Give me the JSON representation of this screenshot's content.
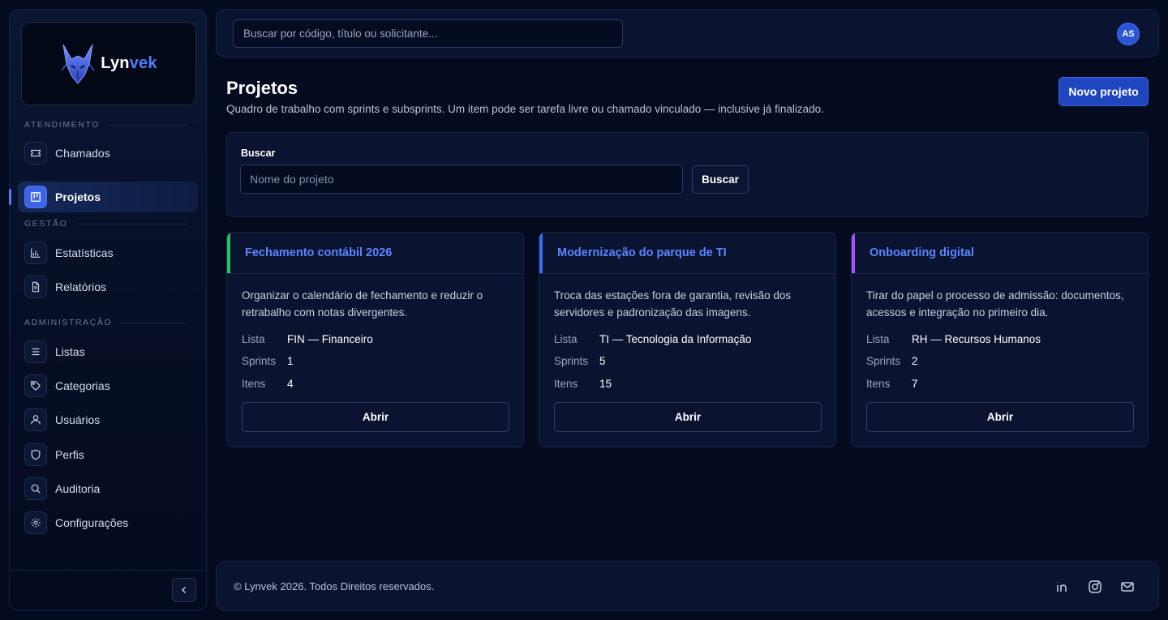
{
  "brand": {
    "name_prefix": "Lyn",
    "name_suffix": "vek",
    "accent_color": "#4f7dff"
  },
  "sidebar": {
    "sections": [
      {
        "title": "ATENDIMENTO"
      },
      {
        "title": "GESTÃO"
      },
      {
        "title": "ADMINISTRAÇÃO"
      }
    ],
    "items": [
      {
        "label": "Chamados",
        "icon": "ticket-icon"
      },
      {
        "label": "Projetos",
        "icon": "kanban-icon",
        "active": true
      },
      {
        "label": "Estatísticas",
        "icon": "bar-chart-icon"
      },
      {
        "label": "Relatórios",
        "icon": "document-icon"
      },
      {
        "label": "Listas",
        "icon": "list-icon"
      },
      {
        "label": "Categorias",
        "icon": "tag-icon"
      },
      {
        "label": "Usuários",
        "icon": "user-icon"
      },
      {
        "label": "Perfis",
        "icon": "shield-icon"
      },
      {
        "label": "Auditoria",
        "icon": "search-icon"
      },
      {
        "label": "Configurações",
        "icon": "gear-icon"
      }
    ],
    "collapse_icon": "chevron-left-icon"
  },
  "topbar": {
    "search_placeholder": "Buscar por código, título ou solicitante...",
    "avatar_initials": "AS"
  },
  "header": {
    "title": "Projetos",
    "subtitle": "Quadro de trabalho com sprints e subsprints. Um item pode ser tarefa livre ou chamado vinculado — inclusive já finalizado.",
    "new_button": "Novo projeto"
  },
  "search": {
    "label": "Buscar",
    "placeholder": "Nome do projeto",
    "button": "Buscar"
  },
  "cards": [
    {
      "title": "Fechamento contábil 2026",
      "accent": "#22c55e",
      "description": "Organizar o calendário de fechamento e reduzir o retrabalho com notas divergentes.",
      "lista_label": "Lista",
      "lista": "FIN — Financeiro",
      "sprints_label": "Sprints",
      "sprints": "1",
      "itens_label": "Itens",
      "itens": "4",
      "button": "Abrir"
    },
    {
      "title": "Modernização do parque de TI",
      "accent": "#3b6cf0",
      "description": "Troca das estações fora de garantia, revisão dos servidores e padronização das imagens.",
      "lista_label": "Lista",
      "lista": "TI — Tecnologia da Informação",
      "sprints_label": "Sprints",
      "sprints": "5",
      "itens_label": "Itens",
      "itens": "15",
      "button": "Abrir"
    },
    {
      "title": "Onboarding digital",
      "accent": "#a855f7",
      "description": "Tirar do papel o processo de admissão: documentos, acessos e integração no primeiro dia.",
      "lista_label": "Lista",
      "lista": "RH — Recursos Humanos",
      "sprints_label": "Sprints",
      "sprints": "2",
      "itens_label": "Itens",
      "itens": "7",
      "button": "Abrir"
    }
  ],
  "footer": {
    "copyright": "© Lynvek 2026. Todos Direitos reservados.",
    "social_icons": [
      "linkedin-icon",
      "instagram-icon",
      "mail-icon"
    ]
  }
}
